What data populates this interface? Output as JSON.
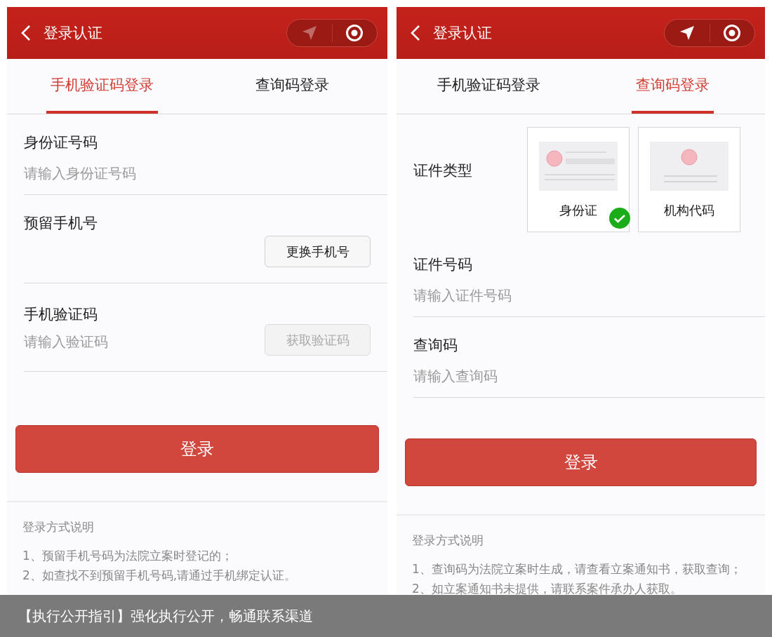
{
  "screens": [
    {
      "header": {
        "title": "登录认证",
        "location_on": false
      },
      "tabs": [
        {
          "label": "手机验证码登录",
          "selected": true
        },
        {
          "label": "查询码登录",
          "selected": false
        }
      ],
      "fields": [
        {
          "kind": "input",
          "label": "身份证号码",
          "placeholder": "请输入身份证号码"
        },
        {
          "kind": "phone",
          "label": "预留手机号",
          "button": {
            "label": "更换手机号",
            "disabled": false
          }
        },
        {
          "kind": "code",
          "label": "手机验证码",
          "placeholder": "请输入验证码",
          "button": {
            "label": "获取验证码",
            "disabled": true
          }
        }
      ],
      "login_button": "登录",
      "notes": {
        "title": "登录方式说明",
        "lines": [
          "1、预留手机号码为法院立案时登记的；",
          "2、如查找不到预留手机号码,请通过手机绑定认证。"
        ]
      }
    },
    {
      "header": {
        "title": "登录认证",
        "location_on": true
      },
      "tabs": [
        {
          "label": "手机验证码登录",
          "selected": false
        },
        {
          "label": "查询码登录",
          "selected": true
        }
      ],
      "fields": [
        {
          "kind": "doc_type",
          "label": "证件类型",
          "options": [
            {
              "label": "身份证",
              "selected": true,
              "kind": "person"
            },
            {
              "label": "机构代码",
              "selected": false,
              "kind": "org"
            }
          ]
        },
        {
          "kind": "input",
          "label": "证件号码",
          "placeholder": "请输入证件号码"
        },
        {
          "kind": "input",
          "label": "查询码",
          "placeholder": "请输入查询码"
        }
      ],
      "login_button": "登录",
      "notes": {
        "title": "登录方式说明",
        "lines": [
          "1、查询码为法院立案时生成，请查看立案通知书，获取查询；",
          "2、如立案通知书未提供，请联系案件承办人获取。"
        ]
      }
    }
  ],
  "caption": "【执行公开指引】强化执行公开，畅通联系渠道"
}
